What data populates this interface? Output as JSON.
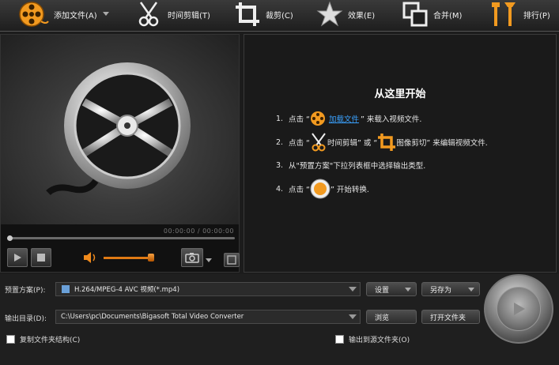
{
  "toolbar": {
    "add_file": "添加文件(A)",
    "clip": "时间剪辑(T)",
    "crop": "裁剪(C)",
    "effect": "效果(E)",
    "merge": "合并(M)",
    "tools": "排行(P)"
  },
  "preview": {
    "timecode": "00:00:00 / 00:00:00"
  },
  "guide": {
    "title": "从这里开始",
    "step1_num": "1.",
    "step1_a": "点击 “",
    "step1_link": "加载文件",
    "step1_b": "” 来载入视频文件.",
    "step2_num": "2.",
    "step2_a": "点击 “",
    "step2_b": "时间剪辑” 或 “",
    "step2_c": "图像剪切” 来编辑视频文件.",
    "step3_num": "3.",
    "step3_a": "从\"预置方案\"下拉列表框中选择输出类型.",
    "step4_num": "4.",
    "step4_a": "点击 “",
    "step4_b": "” 开始转换."
  },
  "output": {
    "profile_label": "预置方案(P):",
    "profile_value": "H.264/MPEG-4 AVC 视频(*.mp4)",
    "settings_btn": "设置",
    "save_as_btn": "另存为",
    "dir_label": "输出目录(D):",
    "dir_value": "C:\\Users\\pc\\Documents\\Bigasoft Total Video Converter",
    "browse_btn": "浏览",
    "open_folder_btn": "打开文件夹",
    "copy_structure_label": "复制文件夹结构(C)",
    "output_to_source_label": "输出到源文件夹(O)"
  },
  "colors": {
    "accent_orange": "#f08a1c",
    "link_blue": "#3aa2ff"
  }
}
